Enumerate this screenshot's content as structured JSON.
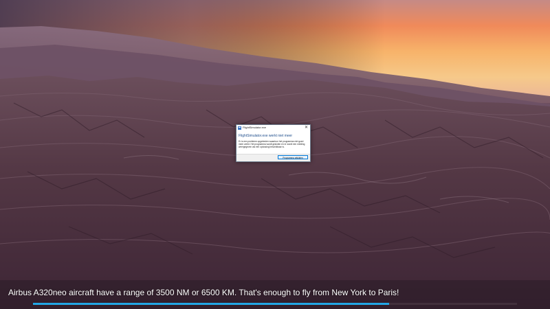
{
  "scene": {
    "description_icon": "mountain-landscape-at-dusk"
  },
  "dialog": {
    "title": "FlightSimulator.exe",
    "close_icon": "close-icon",
    "heading": "FlightSimulator.exe werkt niet meer",
    "message": "Er is een probleem opgetreden waardoor het programma niet goed meer werkt. Het programma wordt gesloten en er wordt een melding weergegeven als een oplossing beschikbaar is.",
    "button_label": "Programma afsluiten",
    "accent_color": "#1f4e8c"
  },
  "loading": {
    "tip": "Airbus A320neo aircraft have a range of 3500 NM or 6500 KM. That's enough to fly from New York to Paris!",
    "progress": 0.736,
    "progress_color": "#22a7e6"
  }
}
